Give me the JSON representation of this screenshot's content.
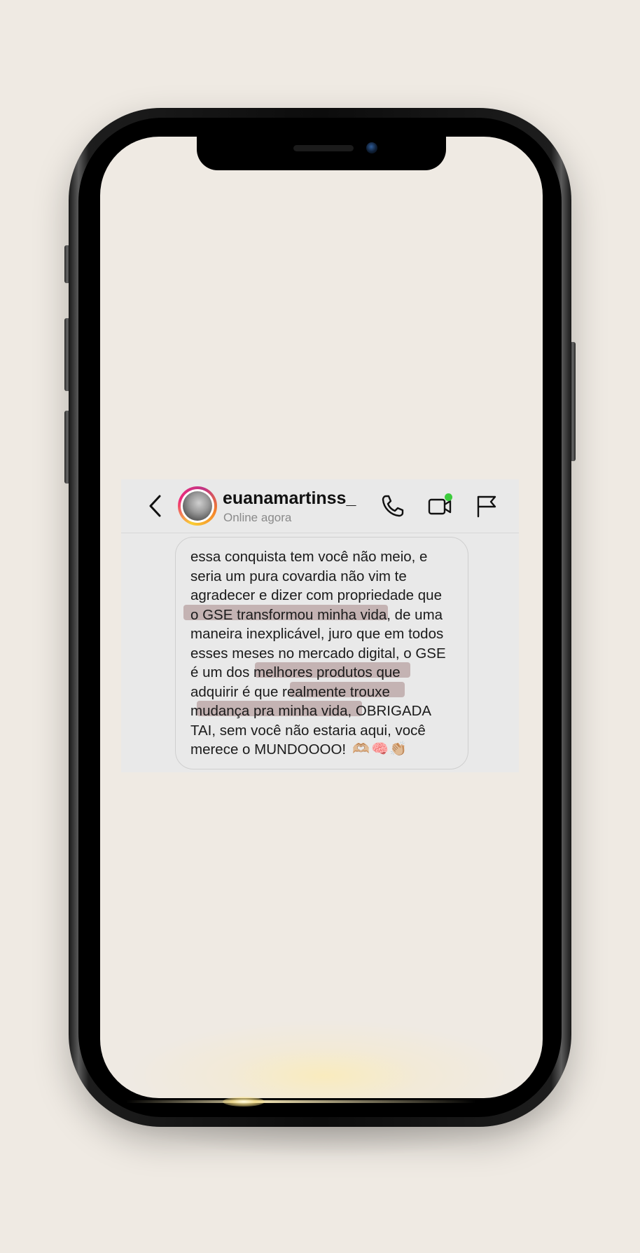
{
  "chat": {
    "username": "euanamartinss_",
    "status": "Online agora",
    "message": "essa conquista tem você não meio, e\nseria um pura covardia não vim te\nagradecer e dizer com propriedade que\no GSE transformou minha vida, de uma\nmaneira inexplicável, juro que em todos\nesses meses no mercado digital, o GSE\né um dos melhores produtos que\nadquirir é que realmente trouxe\nmudança pra minha vida, OBRIGADA\nTAI, sem você não estaria aqui, você\nmerece o MUNDOOOO!",
    "emojis": [
      "🫶🏼",
      "🧠",
      "👏🏼"
    ],
    "highlights": [
      "o GSE transformou minha vida",
      "melhores produtos que",
      "ealmente trouxe",
      "udança pra minha vida,"
    ]
  },
  "icons": {
    "back": "chevron-left-icon",
    "call": "phone-icon",
    "video": "video-camera-icon",
    "report": "flag-icon",
    "online_indicator_color": "#3ccb3c"
  }
}
